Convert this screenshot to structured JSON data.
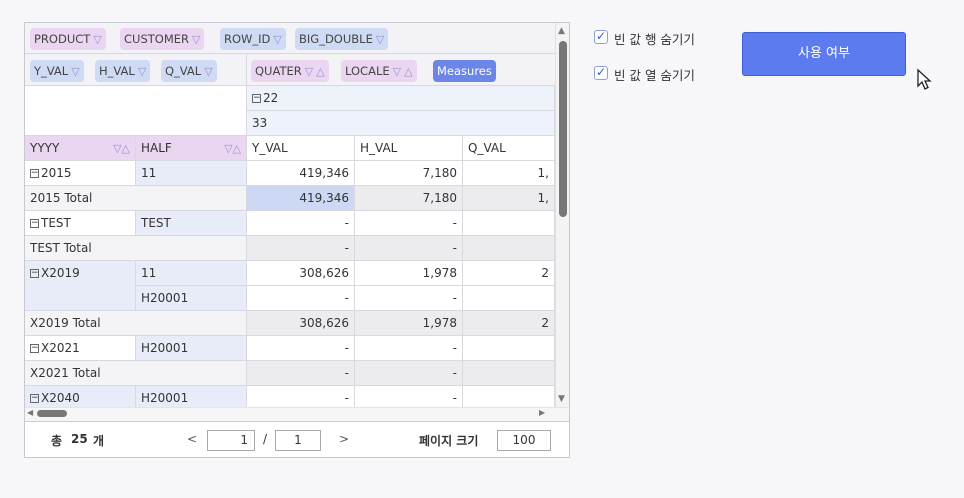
{
  "pivot": {
    "filter_fields": [
      "PRODUCT",
      "CUSTOMER",
      "ROW_ID",
      "BIG_DOUBLE"
    ],
    "data_fields": [
      "Y_VAL",
      "H_VAL",
      "Q_VAL"
    ],
    "column_fields": [
      "QUATER",
      "LOCALE"
    ],
    "measures_label": "Measures",
    "col_header_1": "22",
    "col_header_2": "33",
    "row_fields": [
      "YYYY",
      "HALF"
    ],
    "value_headers": [
      "Y_VAL",
      "H_VAL",
      "Q_VAL"
    ],
    "rows": [
      {
        "yyyy": "2015",
        "half": "11",
        "y": "419,346",
        "h": "7,180",
        "q": "1,"
      },
      {
        "yyyy": "2015 Total",
        "half": "",
        "y": "419,346",
        "h": "7,180",
        "q": "1,"
      },
      {
        "yyyy": "TEST",
        "half": "TEST",
        "y": "-",
        "h": "-",
        "q": ""
      },
      {
        "yyyy": "TEST Total",
        "half": "",
        "y": "-",
        "h": "-",
        "q": ""
      },
      {
        "yyyy": "X2019",
        "half": "11",
        "y": "308,626",
        "h": "1,978",
        "q": "2"
      },
      {
        "yyyy": "",
        "half": "H20001",
        "y": "-",
        "h": "-",
        "q": ""
      },
      {
        "yyyy": "X2019 Total",
        "half": "",
        "y": "308,626",
        "h": "1,978",
        "q": "2"
      },
      {
        "yyyy": "X2021",
        "half": "H20001",
        "y": "-",
        "h": "-",
        "q": ""
      },
      {
        "yyyy": "X2021 Total",
        "half": "",
        "y": "-",
        "h": "-",
        "q": ""
      },
      {
        "yyyy": "X2040",
        "half": "H20001",
        "y": "-",
        "h": "-",
        "q": ""
      }
    ]
  },
  "footer": {
    "total_label": "총",
    "total_count": "25",
    "total_unit": "개",
    "prev": "<",
    "next": ">",
    "current_page": "1",
    "separator": "/",
    "total_pages": "1",
    "page_size_label": "페이지 크기",
    "page_size": "100"
  },
  "options": {
    "hide_empty_rows": "빈 값 행 숨기기",
    "hide_empty_cols": "빈 값 열 숨기기",
    "use_button": "사용 여부"
  }
}
